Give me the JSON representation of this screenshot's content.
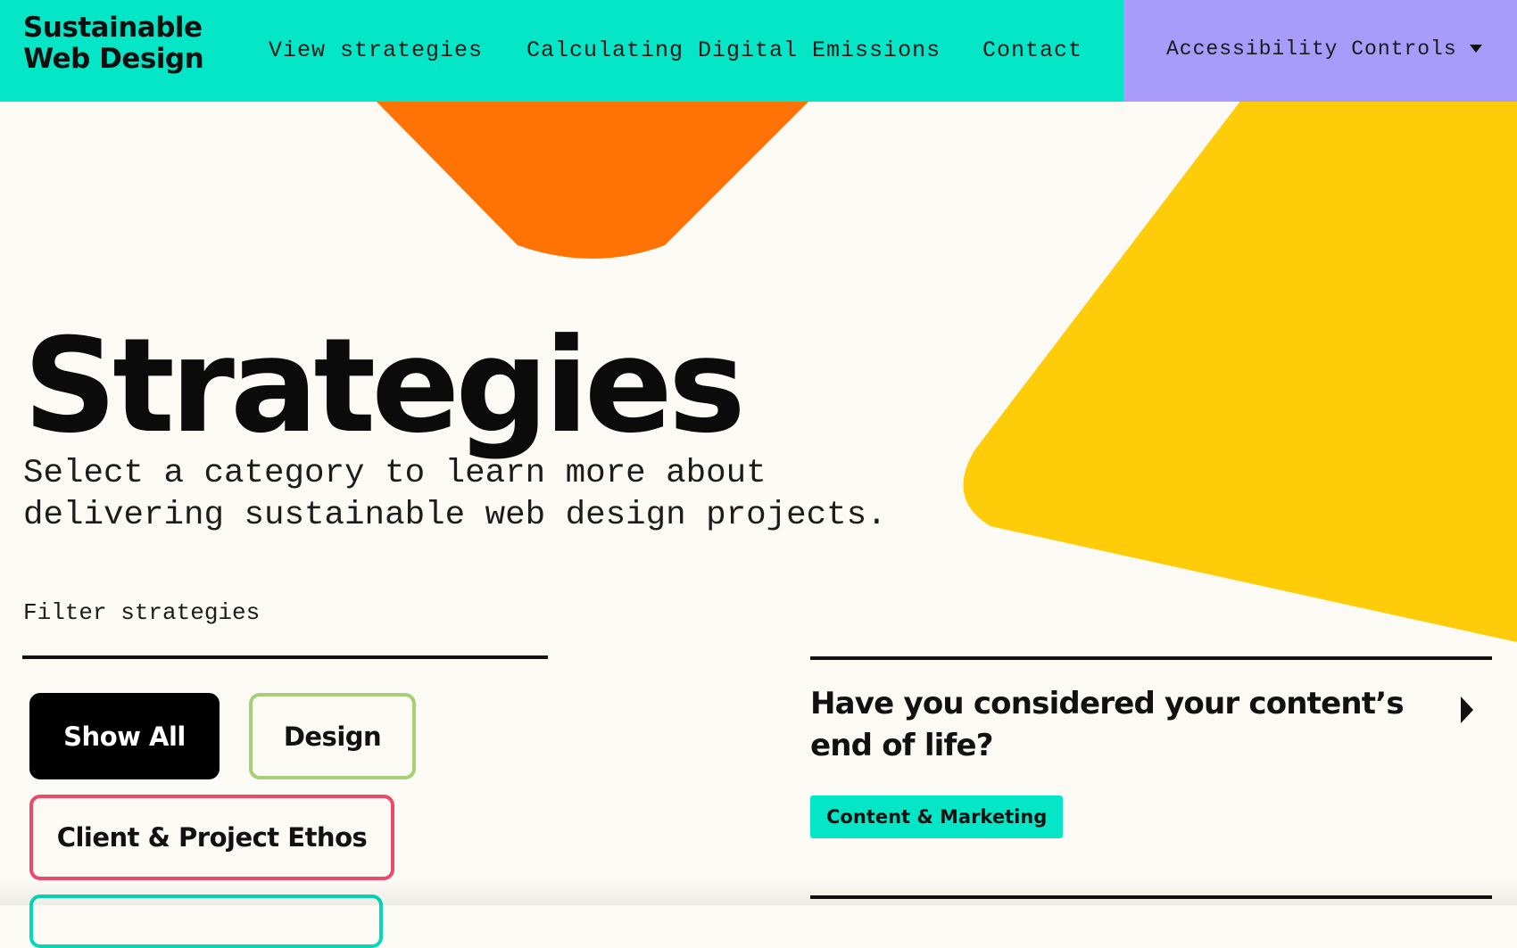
{
  "site": {
    "logo_line1": "Sustainable",
    "logo_line2": "Web Design"
  },
  "nav": {
    "items": [
      {
        "label": "View strategies"
      },
      {
        "label": "Calculating Digital Emissions"
      },
      {
        "label": "Contact"
      }
    ],
    "accessibility_label": "Accessibility Controls"
  },
  "hero": {
    "title": "Strategies",
    "intro_line1": "Select a category to learn more about",
    "intro_line2": "delivering sustainable web design projects."
  },
  "filters": {
    "label": "Filter strategies",
    "buttons": [
      {
        "label": "Show All",
        "selected": true
      },
      {
        "label": "Design",
        "border_color": "#a6cf78"
      },
      {
        "label": "Client & Project Ethos",
        "border_color": "#ec4a6a"
      }
    ]
  },
  "strategy": {
    "title": "Have you considered your content’s end of life?",
    "tag": "Content & Marketing",
    "arrow_icon": "caret-right-icon"
  },
  "colors": {
    "header_bg": "#05e6c6",
    "accessibility_bg": "#a99bfa",
    "page_bg": "#fbfaf4",
    "orange_shape": "#ff7304",
    "yellow_shape": "#fecc09",
    "tag_bg": "#05e6c6"
  }
}
